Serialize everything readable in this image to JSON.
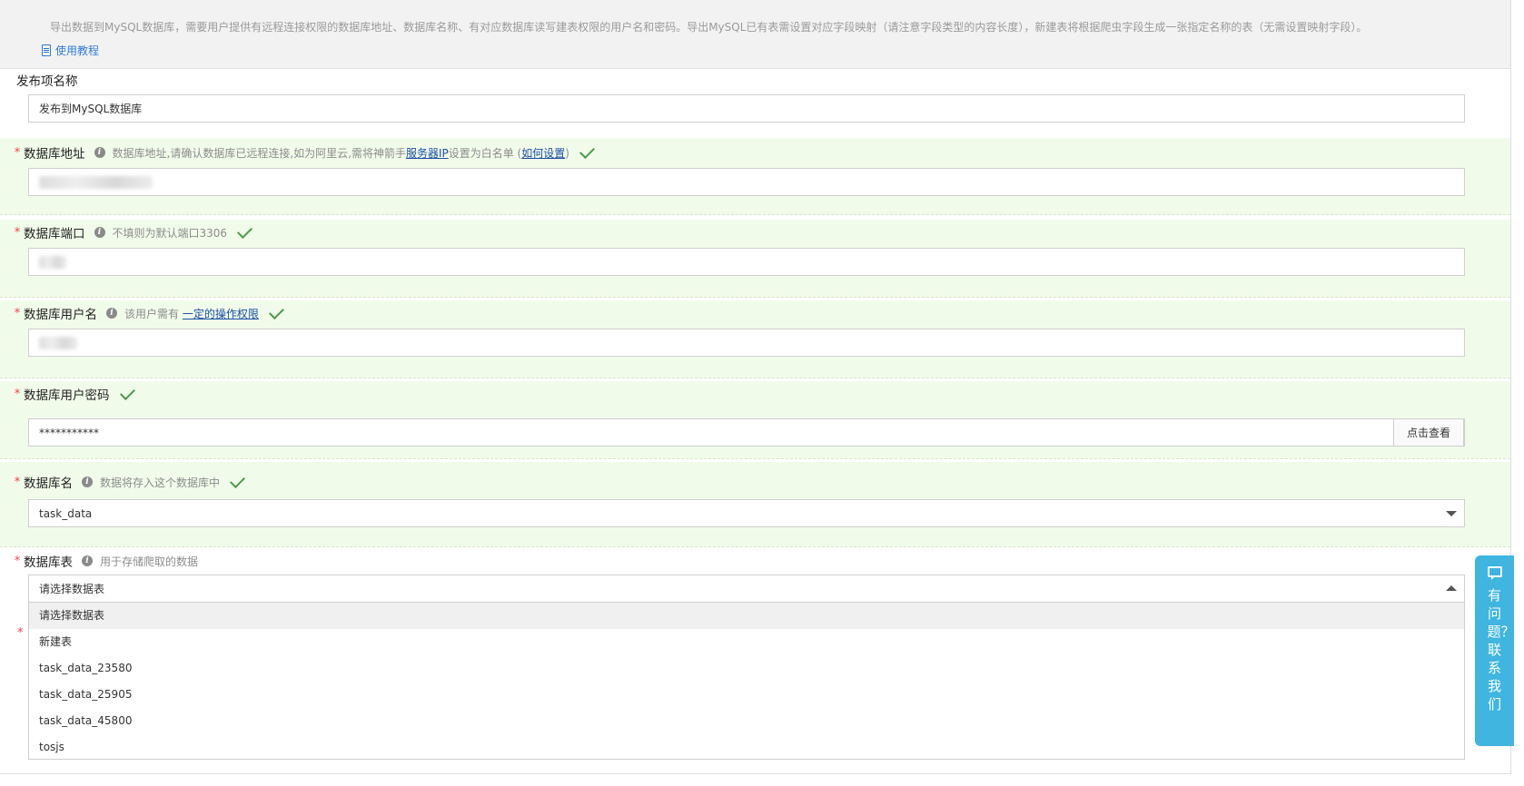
{
  "notice": {
    "text": "导出数据到MySQL数据库，需要用户提供有远程连接权限的数据库地址、数据库名称、有对应数据库读写建表权限的用户名和密码。导出MySQL已有表需设置对应字段映射（请注意字段类型的内容长度），新建表将根据爬虫字段生成一张指定名称的表（无需设置映射字段）。",
    "tutorial_link": "使用教程"
  },
  "publish_name": {
    "label": "发布项名称",
    "value": "发布到MySQL数据库"
  },
  "db_address": {
    "required_mark": "*",
    "label": "数据库地址",
    "hint_prefix": "数据库地址,请确认数据库已远程连接,如为阿里云,需将神箭手",
    "hint_link1": "服务器IP",
    "hint_middle": "设置为白名单 (",
    "hint_link2": "如何设置",
    "hint_suffix": ")"
  },
  "db_port": {
    "required_mark": "*",
    "label": "数据库端口",
    "hint": "不填则为默认端口3306"
  },
  "db_user": {
    "required_mark": "*",
    "label": "数据库用户名",
    "hint_prefix": "该用户需有",
    "hint_link": "一定的操作权限"
  },
  "db_password": {
    "required_mark": "*",
    "label": "数据库用户密码",
    "value": "***********",
    "reveal_button": "点击查看"
  },
  "db_name": {
    "required_mark": "*",
    "label": "数据库名",
    "hint": "数据将存入这个数据库中",
    "selected": "task_data"
  },
  "db_table": {
    "required_mark": "*",
    "label": "数据库表",
    "hint": "用于存储爬取的数据",
    "selected": "请选择数据表",
    "options": [
      "请选择数据表",
      "新建表",
      "task_data_23580",
      "task_data_25905",
      "task_data_45800",
      "tosjs"
    ]
  },
  "stray_required_mark": "*",
  "contact": {
    "text": "有问题？联系我们"
  },
  "colors": {
    "success_bg": "#f1fbea",
    "link": "#1a4fa3",
    "accent": "#3fb5df",
    "required": "#e44444"
  }
}
